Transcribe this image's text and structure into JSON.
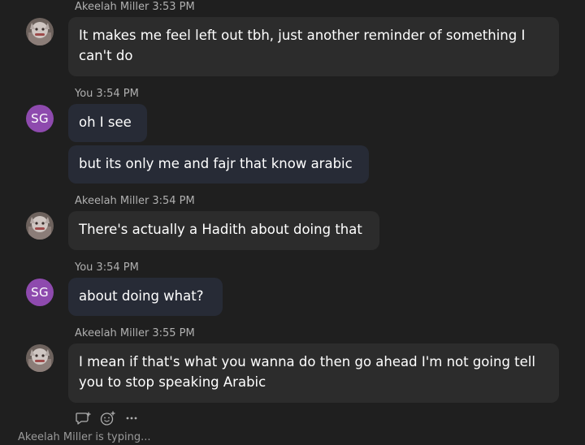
{
  "messages": [
    {
      "sender": "Akeelah Miller",
      "time": "3:53 PM",
      "text": "It makes me feel left out tbh, just another reminder of something I can't do"
    },
    {
      "sender": "You",
      "time": "3:54 PM",
      "avatar_initials": "SG",
      "texts": [
        "oh I see",
        "but its only me and fajr that know arabic"
      ]
    },
    {
      "sender": "Akeelah Miller",
      "time": "3:54 PM",
      "text": "There's actually a Hadith about doing that"
    },
    {
      "sender": "You",
      "time": "3:54 PM",
      "avatar_initials": "SG",
      "text": "about doing what?"
    },
    {
      "sender": "Akeelah Miller",
      "time": "3:55 PM",
      "text": "I mean if that's what you wanna do then go ahead I'm not going tell you to stop speaking Arabic"
    }
  ],
  "actions": {
    "reply_icon": "reply-icon",
    "react_icon": "emoji-react-icon",
    "more_icon": "more-options-icon"
  },
  "typing_indicator": "Akeelah Miller  is typing...",
  "colors": {
    "background": "#1f1f1f",
    "bubble_other": "#2c2c2c",
    "bubble_mine": "#272b36",
    "avatar_sg": "#8e4aae",
    "meta_text": "#b0b0b0"
  }
}
